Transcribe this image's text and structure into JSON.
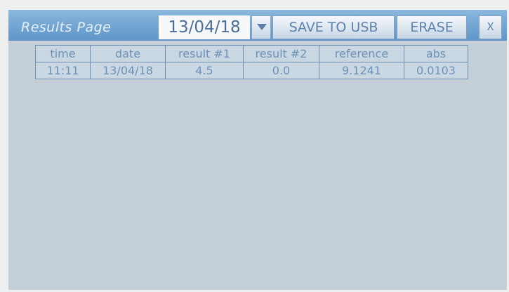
{
  "header": {
    "title": "Results Page",
    "date_selected": "13/04/18",
    "save_label": "SAVE TO USB",
    "erase_label": "ERASE",
    "close_label": "X"
  },
  "table": {
    "columns": [
      "time",
      "date",
      "result #1",
      "result #2",
      "reference",
      "abs"
    ],
    "rows": [
      [
        "11:11",
        "13/04/18",
        "4.5",
        "0.0",
        "9.1241",
        "0.0103"
      ]
    ]
  },
  "colors": {
    "titlebar": "#6f9fcc",
    "screen": "#c4cfd8",
    "text_accent": "#6d92b8"
  },
  "icons": {
    "dropdown": "chevron-down-icon",
    "close": "close-icon"
  }
}
